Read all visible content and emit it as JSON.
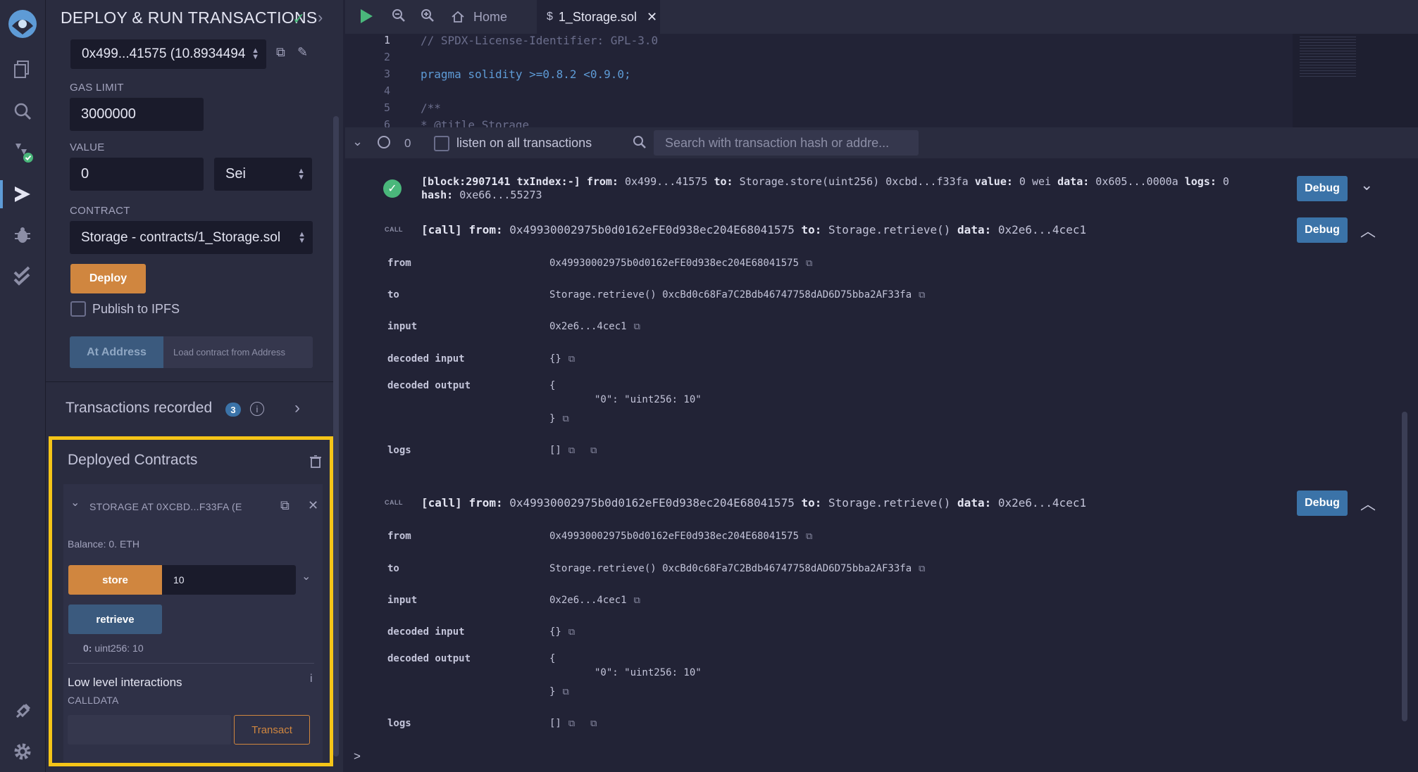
{
  "icons": {
    "logo": "remix-logo-icon",
    "file_explorer": "files-icon",
    "search": "search-icon",
    "compiler": "solidity-compiler-icon",
    "deploy": "deploy-run-icon",
    "debugger": "bug-icon",
    "testing": "double-check-icon",
    "plugin": "plug-icon",
    "settings": "gear-icon"
  },
  "panel": {
    "title": "DEPLOY & RUN TRANSACTIONS",
    "account_value": "0x499...41575 (10.8934494",
    "gas_limit_label": "GAS LIMIT",
    "gas_limit_value": "3000000",
    "value_label": "VALUE",
    "value_amount": "0",
    "value_unit": "Sei",
    "contract_label": "CONTRACT",
    "contract_value": "Storage - contracts/1_Storage.sol",
    "deploy_label": "Deploy",
    "publish_label": "Publish to IPFS",
    "at_address_label": "At Address",
    "load_contract_label": "Load contract from Address",
    "tx_recorded_label": "Transactions recorded",
    "tx_recorded_count": "3"
  },
  "deployed": {
    "title": "Deployed Contracts",
    "instance_label": "STORAGE AT 0XCBD...F33FA (E",
    "balance": "Balance: 0. ETH",
    "store_label": "store",
    "store_input": "10",
    "retrieve_label": "retrieve",
    "result_key": "0:",
    "result_value": "uint256: 10",
    "low_level_label": "Low level interactions",
    "calldata_label": "CALLDATA",
    "transact_label": "Transact"
  },
  "editor": {
    "home_tab": "Home",
    "file_tab": "1_Storage.sol",
    "lines": [
      {
        "n": "1",
        "text": "// SPDX-License-Identifier: GPL-3.0"
      },
      {
        "n": "2",
        "text": ""
      },
      {
        "n": "3",
        "text": "pragma solidity >=0.8.2 <0.9.0;"
      },
      {
        "n": "4",
        "text": ""
      },
      {
        "n": "5",
        "text": "/**"
      },
      {
        "n": "6",
        "text": " * @title Storage"
      }
    ]
  },
  "terminal": {
    "pending_count": "0",
    "listen_label": "listen on all transactions",
    "search_placeholder": "Search with transaction hash or addre...",
    "tx1_line1_pre": "[block:2907141 txIndex:-]",
    "tx1_from_key": "from:",
    "tx1_from_val": "0x499...41575",
    "tx1_to_key": "to:",
    "tx1_to_val": "Storage.store(uint256) 0xcbd...f33fa",
    "tx1_value_key": "value:",
    "tx1_value_val": "0 wei",
    "tx1_data_key": "data:",
    "tx1_data_val": "0x605...0000a",
    "tx1_logs_key": "logs:",
    "tx1_logs_val": "0",
    "tx1_hash_key": "hash:",
    "tx1_hash_val": "0xe66...55273",
    "call_tag": "CALL",
    "call_prefix": "[call]",
    "call_from_key": "from:",
    "call_from_val": "0x49930002975b0d0162eFE0d938ec204E68041575",
    "call_to_key": "to:",
    "call_to_val": "Storage.retrieve()",
    "call_data_key": "data:",
    "call_data_val": "0x2e6...4cec1",
    "debug_label": "Debug",
    "rows": {
      "from_key": "from",
      "from_val": "0x49930002975b0d0162eFE0d938ec204E68041575",
      "to_key": "to",
      "to_val": "Storage.retrieve() 0xcBd0c68Fa7C2Bdb46747758dAD6D75bba2AF33fa",
      "input_key": "input",
      "input_val": "0x2e6...4cec1",
      "decoded_input_key": "decoded input",
      "decoded_input_val": "{}",
      "decoded_output_key": "decoded output",
      "decoded_output_open": "{",
      "decoded_output_body": "\"0\": \"uint256: 10\"",
      "decoded_output_close": "}",
      "logs_key": "logs",
      "logs_val": "[]"
    },
    "prompt": ">"
  },
  "colors": {
    "accent": "#d0863f",
    "debug": "#3b73a8",
    "highlight": "#f5c518",
    "success": "#4ab77b"
  }
}
